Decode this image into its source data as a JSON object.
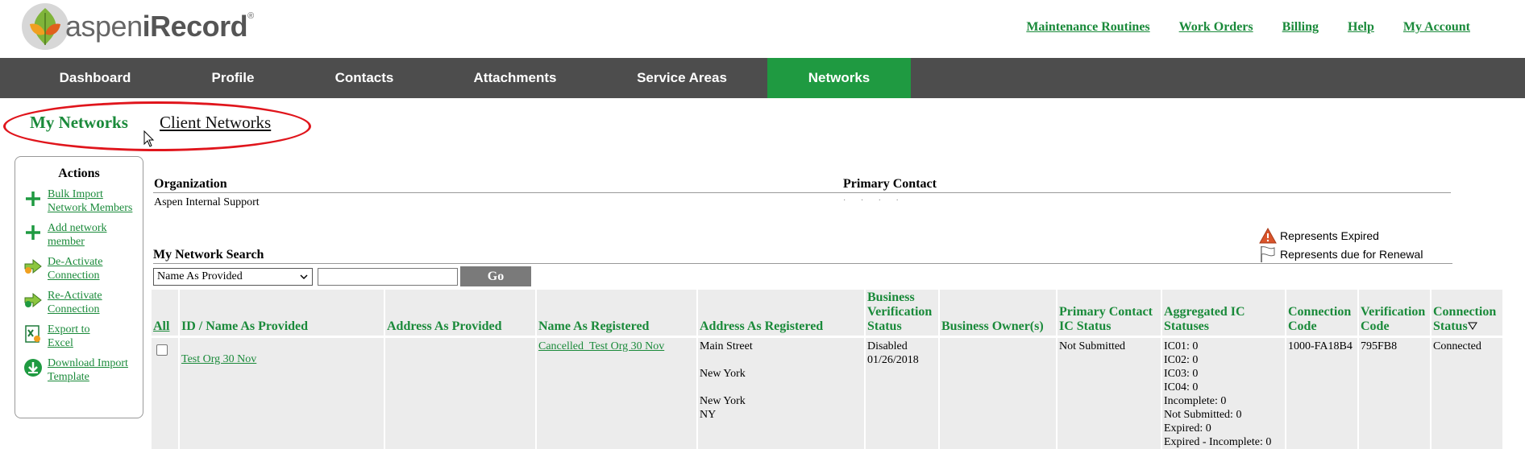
{
  "brand": {
    "prefix": "aspen",
    "bold": "iRecord",
    "mark": "®"
  },
  "top_links": [
    "Maintenance Routines",
    "Work Orders",
    "Billing",
    "Help",
    "My Account"
  ],
  "nav": {
    "items": [
      "Dashboard",
      "Profile",
      "Contacts",
      "Attachments",
      "Service Areas",
      "Networks"
    ],
    "active": "Networks"
  },
  "subtabs": {
    "my": "My Networks",
    "client": "Client Networks"
  },
  "actions": {
    "title": "Actions",
    "items": [
      {
        "label_1": "Bulk Import",
        "label_2": "Network Members",
        "icon": "plus-icon"
      },
      {
        "label_1": "Add network",
        "label_2": "member",
        "icon": "plus-icon"
      },
      {
        "label_1": "De-Activate",
        "label_2": "Connection",
        "icon": "deactivate-arrow-icon"
      },
      {
        "label_1": "Re-Activate",
        "label_2": "Connection",
        "icon": "reactivate-arrow-icon"
      },
      {
        "label_1": "Export to",
        "label_2": "Excel",
        "icon": "excel-icon"
      },
      {
        "label_1": "Download Import",
        "label_2": "Template",
        "icon": "download-icon"
      }
    ]
  },
  "organization": {
    "org_label": "Organization",
    "pc_label": "Primary Contact",
    "org_value": "Aspen Internal Support"
  },
  "legend": {
    "expired": "Represents Expired",
    "renewal": "Represents due for Renewal"
  },
  "search": {
    "title": "My Network Search",
    "select_value": "Name As Provided",
    "input_value": "",
    "go": "Go"
  },
  "table": {
    "headers": {
      "all": "All",
      "id_name": "ID / Name As Provided",
      "addr_provided": "Address As Provided",
      "name_registered": "Name As Registered",
      "addr_registered": "Address As Registered",
      "bv_1": "Business",
      "bv_2": "Verification",
      "bv_3": "Status",
      "owners": "Business Owner(s)",
      "pc_1": "Primary Contact",
      "pc_2": "IC Status",
      "agg_1": "Aggregated IC",
      "agg_2": "Statuses",
      "cc_1": "Connection",
      "cc_2": "Code",
      "vc_1": "Verification",
      "vc_2": "Code",
      "cs_1": "Connection",
      "cs_2": "Status"
    },
    "row": {
      "id_name": "Test Org 30 Nov",
      "name_registered": "Cancelled_Test Org 30 Nov",
      "addr_1": "Main Street",
      "addr_2": "New York",
      "addr_3": "New York",
      "addr_4": "NY",
      "bv_1": "Disabled",
      "bv_2": "01/26/2018",
      "pc_status": "Not Submitted",
      "agg": [
        "IC01: 0",
        "IC02: 0",
        "IC03: 0",
        "IC04: 0",
        "Incomplete: 0",
        "Not Submitted: 0",
        "Expired: 0",
        "Expired - Incomplete: 0"
      ],
      "conn_code": "1000-FA18B4",
      "verif_code": "795FB8",
      "conn_status": "Connected"
    }
  },
  "colors": {
    "accent_green": "#1a8a3a",
    "nav_active": "#1f9a41",
    "nav_bg": "#4d4d4d",
    "highlight_red": "#e0151c"
  }
}
